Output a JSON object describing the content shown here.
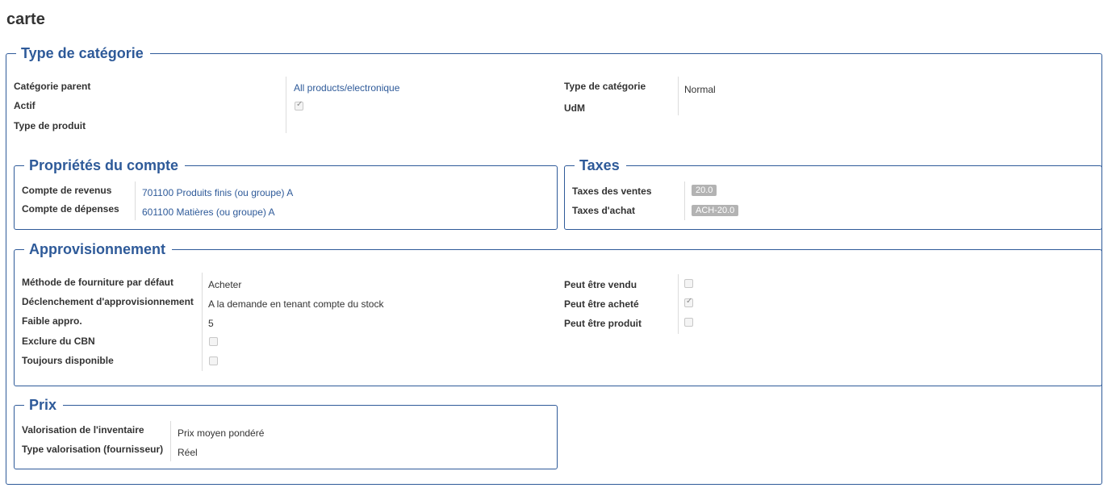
{
  "page_title": "carte",
  "category": {
    "legend": "Type de catégorie",
    "parent_label": "Catégorie parent",
    "parent_value": "All products/electronique",
    "active_label": "Actif",
    "active_checked": true,
    "product_type_label": "Type de produit",
    "category_type_label": "Type de catégorie",
    "category_type_value": "Normal",
    "uom_label": "UdM"
  },
  "accounts": {
    "legend": "Propriétés du compte",
    "revenue_label": "Compte de revenus",
    "revenue_value": "701100 Produits finis (ou groupe) A",
    "expense_label": "Compte de dépenses",
    "expense_value": "601100 Matières (ou groupe) A"
  },
  "taxes": {
    "legend": "Taxes",
    "sales_label": "Taxes des ventes",
    "sales_value": "20.0",
    "purchase_label": "Taxes d'achat",
    "purchase_value": "ACH-20.0"
  },
  "procurement": {
    "legend": "Approvisionnement",
    "supply_method_label": "Méthode de fourniture par défaut",
    "supply_method_value": "Acheter",
    "trigger_label": "Déclenchement d'approvisionnement",
    "trigger_value": "A la demande en tenant compte du stock",
    "low_label": "Faible appro.",
    "low_value": "5",
    "exclude_label": "Exclure du CBN",
    "exclude_checked": false,
    "always_label": "Toujours disponible",
    "always_checked": false,
    "sold_label": "Peut être vendu",
    "sold_checked": false,
    "purchased_label": "Peut être acheté",
    "purchased_checked": true,
    "produced_label": "Peut être produit",
    "produced_checked": false
  },
  "price": {
    "legend": "Prix",
    "valuation_label": "Valorisation de l'inventaire",
    "valuation_value": "Prix moyen pondéré",
    "supplier_valuation_label": "Type valorisation (fournisseur)",
    "supplier_valuation_value": "Réel"
  },
  "colors": {
    "accent": "#2e5a99",
    "badge": "#b3b3b3"
  }
}
